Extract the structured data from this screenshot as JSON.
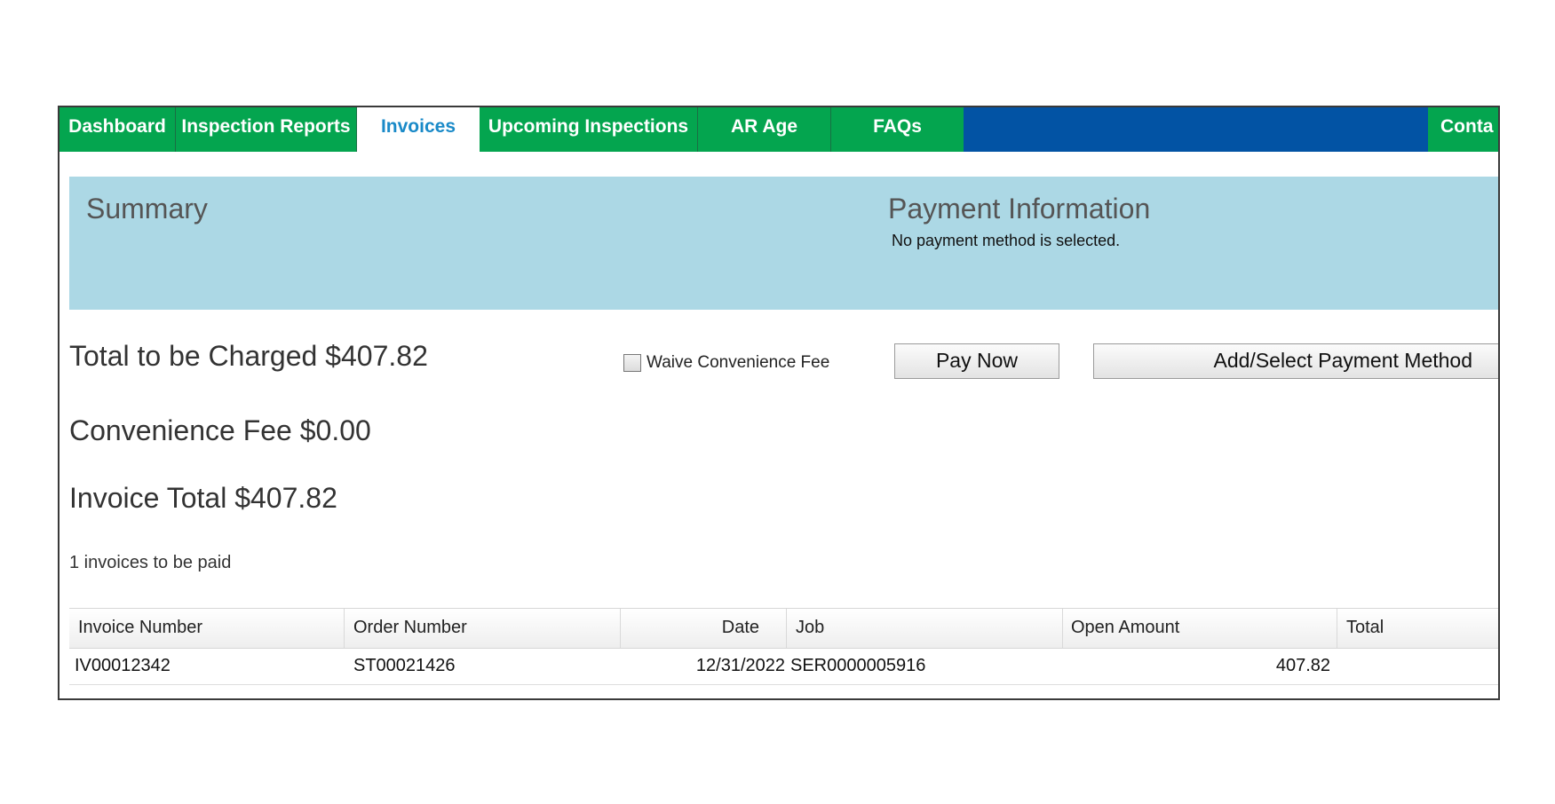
{
  "nav": {
    "tabs": [
      {
        "label": "Dashboard"
      },
      {
        "label": "Inspection Reports"
      },
      {
        "label": "Invoices",
        "active": true
      },
      {
        "label": "Upcoming Inspections"
      },
      {
        "label": "AR Age"
      },
      {
        "label": "FAQs"
      },
      {
        "label": "Conta"
      }
    ],
    "colors": {
      "tab_green": "#04a54f",
      "bar_blue": "#0253a4",
      "active_text": "#1a8ac8"
    }
  },
  "summary": {
    "title": "Summary",
    "payment_title": "Payment Information",
    "payment_note": "No payment method is selected.",
    "panel_color": "#acd8e5"
  },
  "totals": {
    "charged": "Total to be Charged $407.82",
    "convenience_fee": "Convenience Fee $0.00",
    "invoice_total": "Invoice Total $407.82",
    "count_text": "1 invoices to be paid"
  },
  "actions": {
    "waive_label": "Waive Convenience Fee",
    "waive_checked": false,
    "pay_now": "Pay Now",
    "add_payment": "Add/Select Payment Method"
  },
  "table": {
    "columns": [
      "Invoice Number",
      "Order Number",
      "Date",
      "Job",
      "Open Amount",
      "Total"
    ],
    "rows": [
      {
        "invoice_number": "IV00012342",
        "order_number": "ST00021426",
        "date": "12/31/2022",
        "job": "SER0000005916",
        "open_amount": "407.82",
        "total": ""
      }
    ]
  }
}
